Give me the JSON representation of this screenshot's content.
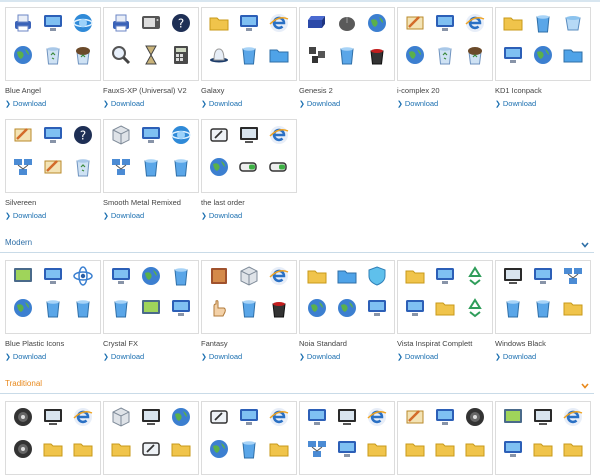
{
  "download_label": "Download",
  "colors": {
    "modern": "#2f6fa7",
    "traditional": "#e8891c",
    "link": "#1b6fb0"
  },
  "sections": [
    {
      "title": "",
      "items": [
        {
          "name": "Blue Angel",
          "icons": [
            "printer",
            "monitor",
            "ie-globe",
            "globe",
            "recycle-bin",
            "recycle-bin-full"
          ]
        },
        {
          "name": "FauxS-XP (Universal) V2",
          "icons": [
            "printer",
            "tv",
            "help-orb",
            "magnifier",
            "hourglass",
            "calculator"
          ]
        },
        {
          "name": "Galaxy",
          "icons": [
            "folder",
            "monitor",
            "ie-e",
            "hat",
            "bin",
            "folder-blue"
          ]
        },
        {
          "name": "Genesis 2",
          "icons": [
            "drive",
            "mouse",
            "globe",
            "pipe",
            "bin",
            "bin-red"
          ]
        },
        {
          "name": "i-complex 20",
          "icons": [
            "settings",
            "monitor",
            "ie-e",
            "globe",
            "recycle-bin",
            "recycle-bin-full"
          ]
        },
        {
          "name": "KD1 Iconpack",
          "icons": [
            "folder",
            "bin",
            "cup",
            "monitor",
            "globe",
            "folder-blue"
          ]
        }
      ]
    },
    {
      "title": "",
      "items": [
        {
          "name": "Silvereen",
          "icons": [
            "settings",
            "monitor",
            "help-orb",
            "network",
            "settings",
            "recycle-bin"
          ]
        },
        {
          "name": "Smooth Metal Remixed",
          "icons": [
            "cube",
            "monitor",
            "ie-globe",
            "network",
            "bin",
            "bin"
          ]
        },
        {
          "name": "the last order",
          "icons": [
            "pen",
            "display",
            "ie-e",
            "globe",
            "battery",
            "battery"
          ]
        }
      ]
    },
    {
      "title": "Modern",
      "items": [
        {
          "name": "Blue Plastic Icons",
          "icons": [
            "screen",
            "monitor",
            "atom",
            "globe",
            "bin",
            "bin"
          ]
        },
        {
          "name": "Crystal FX",
          "icons": [
            "monitor",
            "globe",
            "bin",
            "bin",
            "screen",
            "monitor"
          ]
        },
        {
          "name": "Fantasy",
          "icons": [
            "book",
            "cube",
            "ie-e",
            "hand",
            "bin",
            "bin-red"
          ]
        },
        {
          "name": "Noia Standard",
          "icons": [
            "folder",
            "folder-blue",
            "shield",
            "globe",
            "globe",
            "monitor"
          ]
        },
        {
          "name": "Vista Inspirat Complett",
          "icons": [
            "folder",
            "monitor",
            "recycle",
            "monitor",
            "folder",
            "recycle"
          ]
        },
        {
          "name": "Windows Black",
          "icons": [
            "display",
            "monitor",
            "network",
            "bin",
            "bin",
            "folder"
          ]
        }
      ]
    },
    {
      "title": "Traditional",
      "items": [
        {
          "name": "",
          "icons": [
            "disc",
            "display",
            "ie-e",
            "disc",
            "folder",
            "folder"
          ]
        },
        {
          "name": "",
          "icons": [
            "cube",
            "display",
            "globe",
            "folder",
            "pen",
            "folder"
          ]
        },
        {
          "name": "",
          "icons": [
            "pen",
            "monitor",
            "ie-e",
            "globe",
            "bin",
            "folder"
          ]
        },
        {
          "name": "",
          "icons": [
            "monitor",
            "display",
            "ie-e",
            "network",
            "monitor",
            "folder"
          ]
        },
        {
          "name": "",
          "icons": [
            "settings",
            "monitor",
            "disc",
            "folder",
            "folder",
            "folder"
          ]
        },
        {
          "name": "",
          "icons": [
            "screen",
            "display",
            "ie-e",
            "monitor",
            "folder",
            "folder"
          ]
        }
      ]
    }
  ]
}
